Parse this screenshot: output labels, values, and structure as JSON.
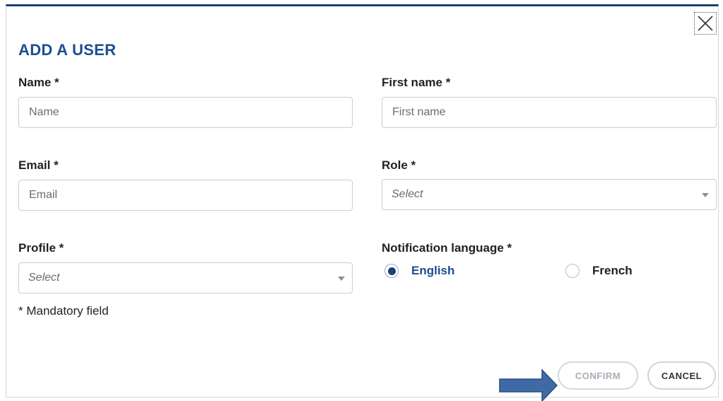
{
  "modal": {
    "title": "ADD A USER",
    "close_icon": "close-icon"
  },
  "form": {
    "name": {
      "label": "Name *",
      "placeholder": "Name",
      "value": ""
    },
    "first_name": {
      "label": "First name *",
      "placeholder": "First name",
      "value": ""
    },
    "email": {
      "label": "Email *",
      "placeholder": "Email",
      "value": ""
    },
    "role": {
      "label": "Role *",
      "selected": "Select"
    },
    "profile": {
      "label": "Profile *",
      "selected": "Select"
    },
    "notification_language": {
      "label": "Notification language *",
      "options": [
        {
          "label": "English",
          "checked": true
        },
        {
          "label": "French",
          "checked": false
        }
      ]
    },
    "mandatory_note": "* Mandatory field"
  },
  "actions": {
    "confirm_label": "CONFIRM",
    "cancel_label": "CANCEL"
  },
  "annotation": {
    "arrow_icon": "right-arrow-icon",
    "arrow_color": "#3f6aa6"
  },
  "colors": {
    "accent": "#1d4e8f",
    "modal_border": "#1d3f73"
  }
}
